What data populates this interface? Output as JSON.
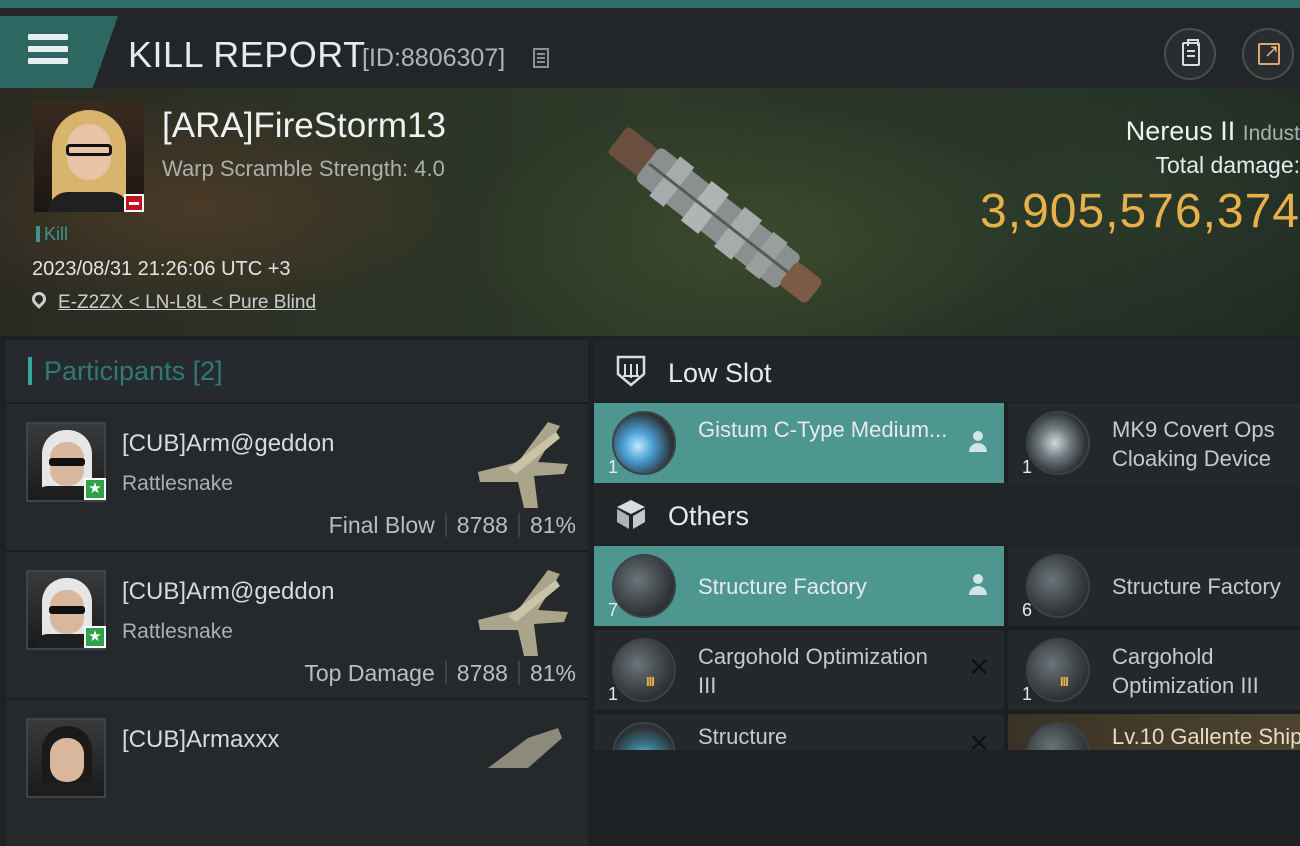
{
  "header": {
    "title": "KILL REPORT",
    "kill_id": "[ID:8806307]",
    "icons": {
      "menu": "hamburger-menu-icon",
      "copy": "copy-icon",
      "clipboard": "clipboard-icon",
      "share": "share-icon"
    }
  },
  "victim": {
    "name": "[ARA]FireStorm13",
    "warp_scramble": "Warp Scramble Strength: 4.0",
    "tag": "Kill",
    "datetime": "2023/08/31 21:26:06 UTC +3",
    "location": "E-Z2ZX < LN-L8L < Pure Blind",
    "ship": "Nereus II",
    "ship_class": "Indust",
    "damage_label": "Total damage:",
    "damage_value": "3,905,576,374"
  },
  "participants": {
    "label": "Participants",
    "count": "[2]",
    "rows": [
      {
        "name": "[CUB]Arm@geddon",
        "ship": "Rattlesnake",
        "role": "Final Blow",
        "damage": "8788",
        "percent": "81%"
      },
      {
        "name": "[CUB]Arm@geddon",
        "ship": "Rattlesnake",
        "role": "Top Damage",
        "damage": "8788",
        "percent": "81%"
      },
      {
        "name": "[CUB]Armaxxx",
        "ship": "",
        "role": "",
        "damage": "",
        "percent": ""
      }
    ]
  },
  "sections": {
    "low_slot": "Low Slot",
    "others": "Others"
  },
  "items": {
    "gistum": {
      "qty": "1",
      "name": "Gistum C-Type Medium..."
    },
    "mk9": {
      "qty": "1",
      "name": "MK9 Covert Ops Cloaking Device"
    },
    "factory_a": {
      "qty": "7",
      "name": "Structure Factory"
    },
    "factory_b": {
      "qty": "6",
      "name": "Structure Factory"
    },
    "cargo_a": {
      "qty": "1",
      "name": "Cargohold Optimization III"
    },
    "cargo_b": {
      "qty": "1",
      "name": "Cargohold Optimization III"
    },
    "structure": {
      "qty": "",
      "name": "Structure"
    },
    "gallente": {
      "qty": "",
      "name": "Lv.10 Gallente Ship"
    }
  },
  "colors": {
    "accent": "#3aa5a0",
    "highlight": "#4e9690",
    "damage": "#e8b04a",
    "danger": "#c4121c",
    "success": "#2ea14a"
  }
}
